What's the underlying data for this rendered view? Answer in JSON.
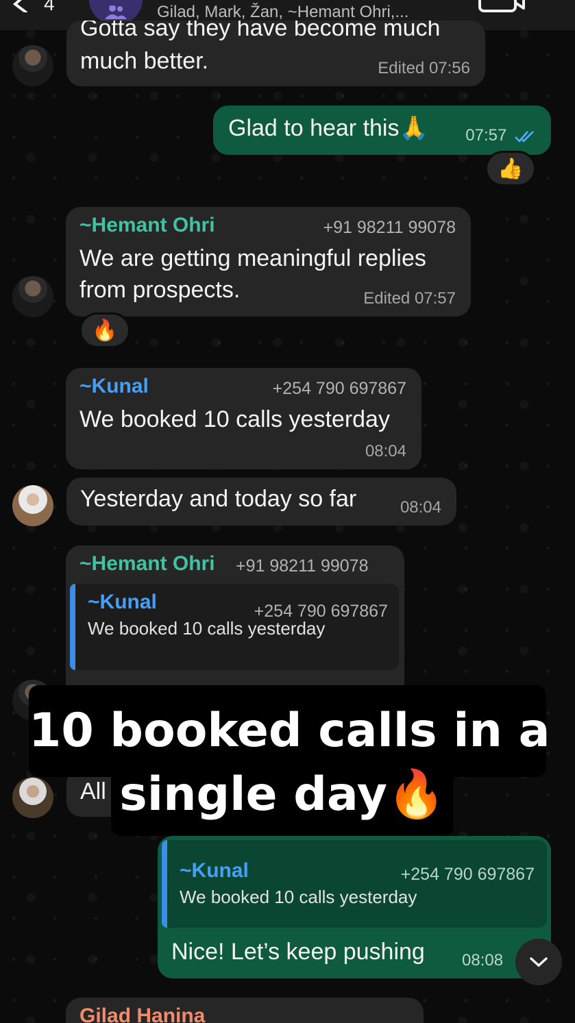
{
  "header": {
    "back_count": "4",
    "members": "Gilad, Mark, Žan, ~Hemant Ohri,..."
  },
  "messages": {
    "m1": {
      "text_top": "Gotta say they have become much",
      "text": "much better.",
      "meta": "Edited 07:56"
    },
    "m2": {
      "text": "Glad to hear this🙏",
      "time": "07:57",
      "reaction": "👍"
    },
    "m3": {
      "sender": "Hemant Ohri",
      "phone": "+91 98211 99078",
      "line1": "We are getting meaningful replies",
      "line2": "from prospects.",
      "meta": "Edited 07:57",
      "reaction": "🔥"
    },
    "m4": {
      "sender": "Kunal",
      "phone": "+254 790 697867",
      "text": "We booked 10 calls yesterday",
      "time": "08:04"
    },
    "m5": {
      "text": "Yesterday and today so far",
      "time": "08:04"
    },
    "m6": {
      "sender": "Hemant Ohri",
      "phone": "+91 98211 99078",
      "quote_sender": "Kunal",
      "quote_phone": "+254 790 697867",
      "quote_text": "We booked 10 calls yesterday"
    },
    "m7": {
      "text": "All"
    },
    "m8": {
      "quote_sender": "Kunal",
      "quote_phone": "+254 790 697867",
      "quote_text": "We booked 10 calls yesterday",
      "text": "Nice! Let’s keep pushing",
      "time": "08:08"
    },
    "m9": {
      "sender": "Gilad Hanina"
    }
  },
  "overlay": {
    "line1": "10 booked calls in a",
    "line2": "single day🔥"
  },
  "colors": {
    "hemant": "#3fc3a3",
    "kunal": "#45a0f5",
    "gilad": "#f28b6b",
    "outgoing": "#0f5b3f"
  }
}
